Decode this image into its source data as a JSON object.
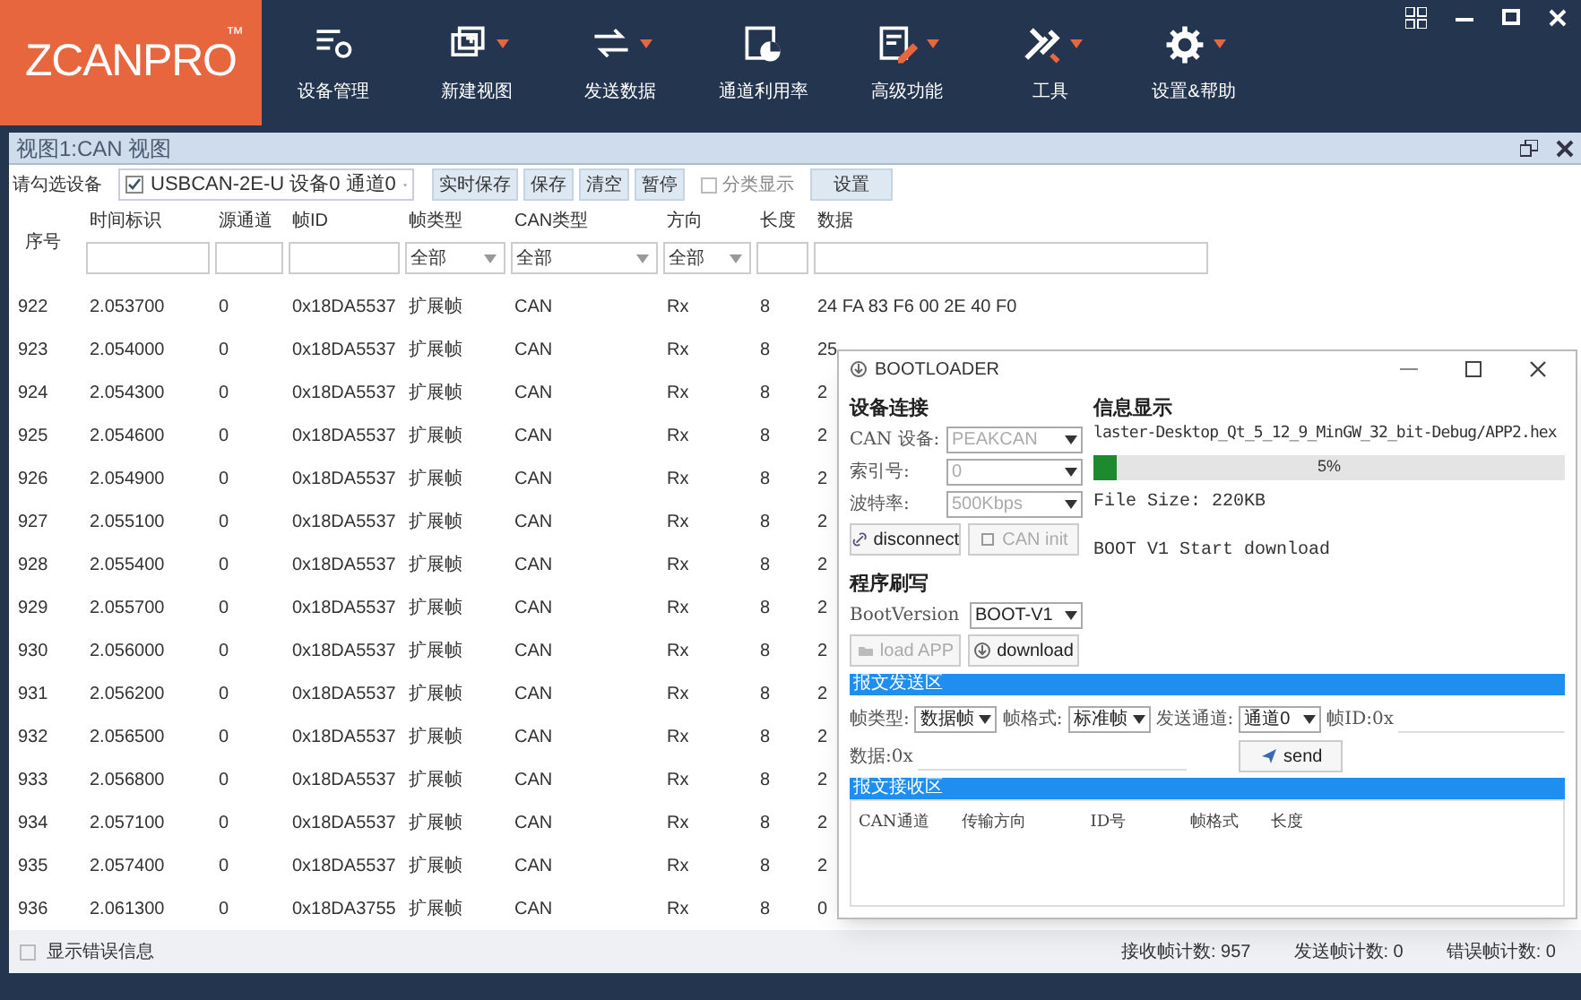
{
  "app": {
    "logo": "ZCANPRO",
    "logo_mark": "™"
  },
  "toolbar": [
    {
      "label": "设备管理",
      "has_menu": false
    },
    {
      "label": "新建视图",
      "has_menu": true
    },
    {
      "label": "发送数据",
      "has_menu": true
    },
    {
      "label": "通道利用率",
      "has_menu": false
    },
    {
      "label": "高级功能",
      "has_menu": true
    },
    {
      "label": "工具",
      "has_menu": true
    },
    {
      "label": "设置&帮助",
      "has_menu": true
    }
  ],
  "view": {
    "title": "视图1:CAN 视图",
    "device_label": "请勾选设备",
    "device": {
      "label": "USBCAN-2E-U 设备0 通道0",
      "checked": true
    },
    "buttons": [
      "实时保存",
      "保存",
      "清空",
      "暂停"
    ],
    "classify": {
      "label": "分类显示",
      "checked": false
    },
    "settings_button": "设置"
  },
  "table": {
    "columns": [
      {
        "label": "序号",
        "kind": "plain"
      },
      {
        "label": "时间标识",
        "kind": "text"
      },
      {
        "label": "源通道",
        "kind": "text"
      },
      {
        "label": "帧ID",
        "kind": "text"
      },
      {
        "label": "帧类型",
        "kind": "select",
        "value": "全部"
      },
      {
        "label": "CAN类型",
        "kind": "select",
        "value": "全部"
      },
      {
        "label": "方向",
        "kind": "select",
        "value": "全部"
      },
      {
        "label": "长度",
        "kind": "text"
      },
      {
        "label": "数据",
        "kind": "text"
      }
    ],
    "rows": [
      [
        "922",
        "2.053700",
        "0",
        "0x18DA5537",
        "扩展帧",
        "CAN",
        "Rx",
        "8",
        "24 FA 83 F6 00 2E 40 F0"
      ],
      [
        "923",
        "2.054000",
        "0",
        "0x18DA5537",
        "扩展帧",
        "CAN",
        "Rx",
        "8",
        "25"
      ],
      [
        "924",
        "2.054300",
        "0",
        "0x18DA5537",
        "扩展帧",
        "CAN",
        "Rx",
        "8",
        "2"
      ],
      [
        "925",
        "2.054600",
        "0",
        "0x18DA5537",
        "扩展帧",
        "CAN",
        "Rx",
        "8",
        "2"
      ],
      [
        "926",
        "2.054900",
        "0",
        "0x18DA5537",
        "扩展帧",
        "CAN",
        "Rx",
        "8",
        "2"
      ],
      [
        "927",
        "2.055100",
        "0",
        "0x18DA5537",
        "扩展帧",
        "CAN",
        "Rx",
        "8",
        "2"
      ],
      [
        "928",
        "2.055400",
        "0",
        "0x18DA5537",
        "扩展帧",
        "CAN",
        "Rx",
        "8",
        "2"
      ],
      [
        "929",
        "2.055700",
        "0",
        "0x18DA5537",
        "扩展帧",
        "CAN",
        "Rx",
        "8",
        "2"
      ],
      [
        "930",
        "2.056000",
        "0",
        "0x18DA5537",
        "扩展帧",
        "CAN",
        "Rx",
        "8",
        "2"
      ],
      [
        "931",
        "2.056200",
        "0",
        "0x18DA5537",
        "扩展帧",
        "CAN",
        "Rx",
        "8",
        "2"
      ],
      [
        "932",
        "2.056500",
        "0",
        "0x18DA5537",
        "扩展帧",
        "CAN",
        "Rx",
        "8",
        "2"
      ],
      [
        "933",
        "2.056800",
        "0",
        "0x18DA5537",
        "扩展帧",
        "CAN",
        "Rx",
        "8",
        "2"
      ],
      [
        "934",
        "2.057100",
        "0",
        "0x18DA5537",
        "扩展帧",
        "CAN",
        "Rx",
        "8",
        "2"
      ],
      [
        "935",
        "2.057400",
        "0",
        "0x18DA5537",
        "扩展帧",
        "CAN",
        "Rx",
        "8",
        "2"
      ],
      [
        "936",
        "2.061300",
        "0",
        "0x18DA3755",
        "扩展帧",
        "CAN",
        "Rx",
        "8",
        "0"
      ]
    ]
  },
  "footer": {
    "show_errors": {
      "label": "显示错误信息",
      "checked": false
    },
    "counts": [
      "接收帧计数: 957",
      "发送帧计数: 0",
      "错误帧计数: 0"
    ]
  },
  "dialog": {
    "title": "BOOTLOADER",
    "device": {
      "heading": "设备连接",
      "fields": [
        {
          "label": "CAN 设备:",
          "value": "PEAKCAN"
        },
        {
          "label": "索引号:",
          "value": "0"
        },
        {
          "label": "波特率:",
          "value": "500Kbps"
        }
      ],
      "buttons": [
        {
          "label": "disconnect",
          "disabled": false
        },
        {
          "label": "CAN init",
          "disabled": true
        }
      ]
    },
    "info": {
      "heading": "信息显示",
      "path": "laster-Desktop_Qt_5_12_9_MinGW_32_bit-Debug/APP2.hex",
      "progress": {
        "level": 0.05,
        "text": "5%"
      },
      "lines": [
        "File Size: 220KB",
        "BOOT V1 Start download"
      ]
    },
    "program": {
      "heading": "程序刷写",
      "version_label": "BootVersion",
      "version": "BOOT-V1",
      "buttons": [
        {
          "label": "load APP",
          "disabled": true
        },
        {
          "label": "download",
          "disabled": false
        }
      ]
    },
    "send": {
      "heading": "报文发送区",
      "selects": [
        {
          "label": "帧类型:",
          "value": "数据帧"
        },
        {
          "label": "帧格式:",
          "value": "标准帧"
        },
        {
          "label": "发送通道:",
          "value": "通道0"
        }
      ],
      "id_label": "帧ID:0x",
      "data_label": "数据:0x",
      "button": "send"
    },
    "receive": {
      "heading": "报文接收区",
      "columns": [
        "CAN通道",
        "传输方向",
        "ID号",
        "帧格式",
        "长度"
      ]
    }
  }
}
